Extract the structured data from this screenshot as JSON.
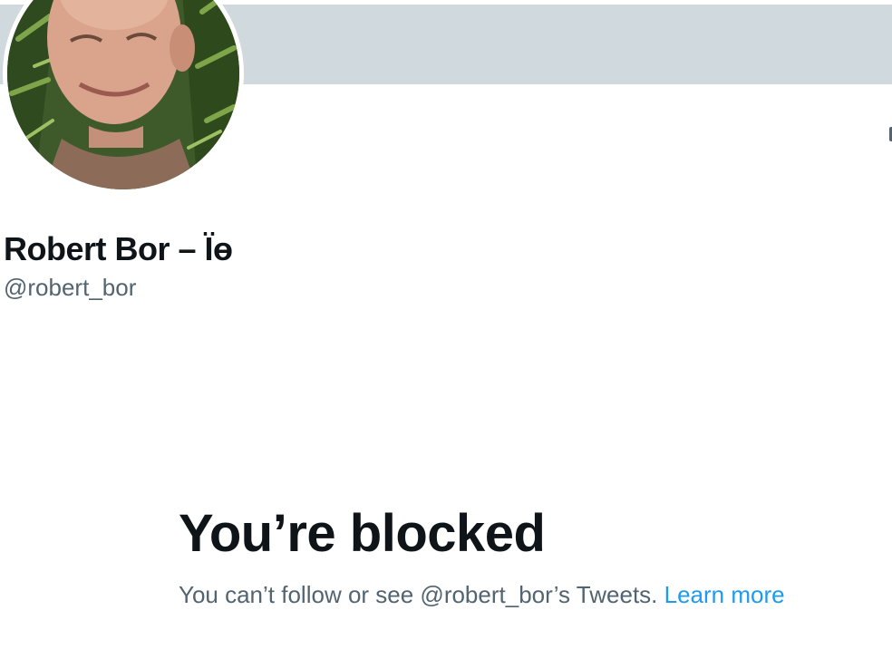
{
  "profile": {
    "display_name": "Robert Bor – Ïɵ",
    "handle": "@robert_bor",
    "avatar_icon": "profile-photo",
    "banner_color": "#cfd9de"
  },
  "blocked_notice": {
    "title": "You’re blocked",
    "description": "You can’t follow or see @robert_bor’s Tweets.",
    "learn_more_label": "Learn more",
    "link_color": "#1d9bf0"
  }
}
